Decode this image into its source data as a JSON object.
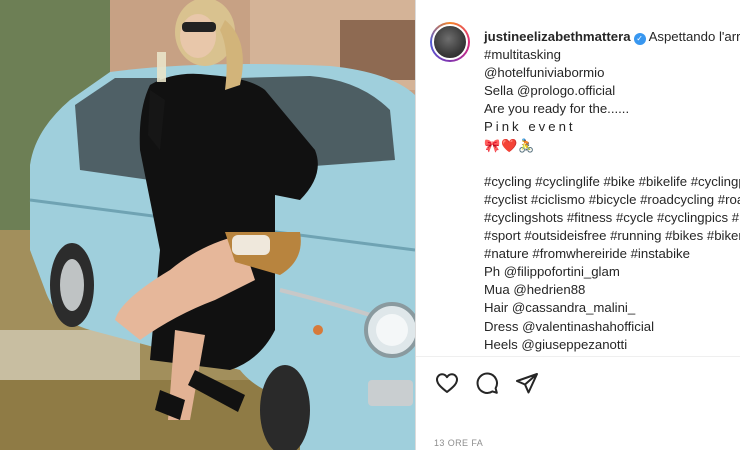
{
  "post": {
    "username": "justineelizabethmattera",
    "verified_icon": "verified-badge-icon",
    "caption_first": "Aspettando l'arrivo delle",
    "lines": [
      "#multitasking",
      "@hotelfuniviabormio",
      "Sella @prologo.official",
      "Are you ready for the......",
      "Pink event",
      "🎀❤️🚴",
      "",
      "#cycling #cyclinglife #bike #bikelife #cyclingphotos",
      "#cyclist #ciclismo #bicycle #roadcycling #roadbike",
      "#cyclingshots #fitness #cycle #cyclingpics #bikes",
      "#sport #outsideisfree #running #bikes #bikeride",
      "#nature #fromwhereiride #instabike",
      "Ph @filippofortini_glam",
      "Mua @hedrien88",
      "Hair @cassandra_malini_",
      "Dress @valentinashahofficial",
      "Heels @giuseppezanotti"
    ],
    "timestamp": "13 ORE FA"
  },
  "actions": {
    "like_icon": "heart-icon",
    "comment_icon": "comment-icon",
    "share_icon": "share-icon"
  },
  "colors": {
    "verified": "#3897f0",
    "text": "#262626",
    "muted": "#8e8e8e",
    "car": "#9fcfdc"
  }
}
